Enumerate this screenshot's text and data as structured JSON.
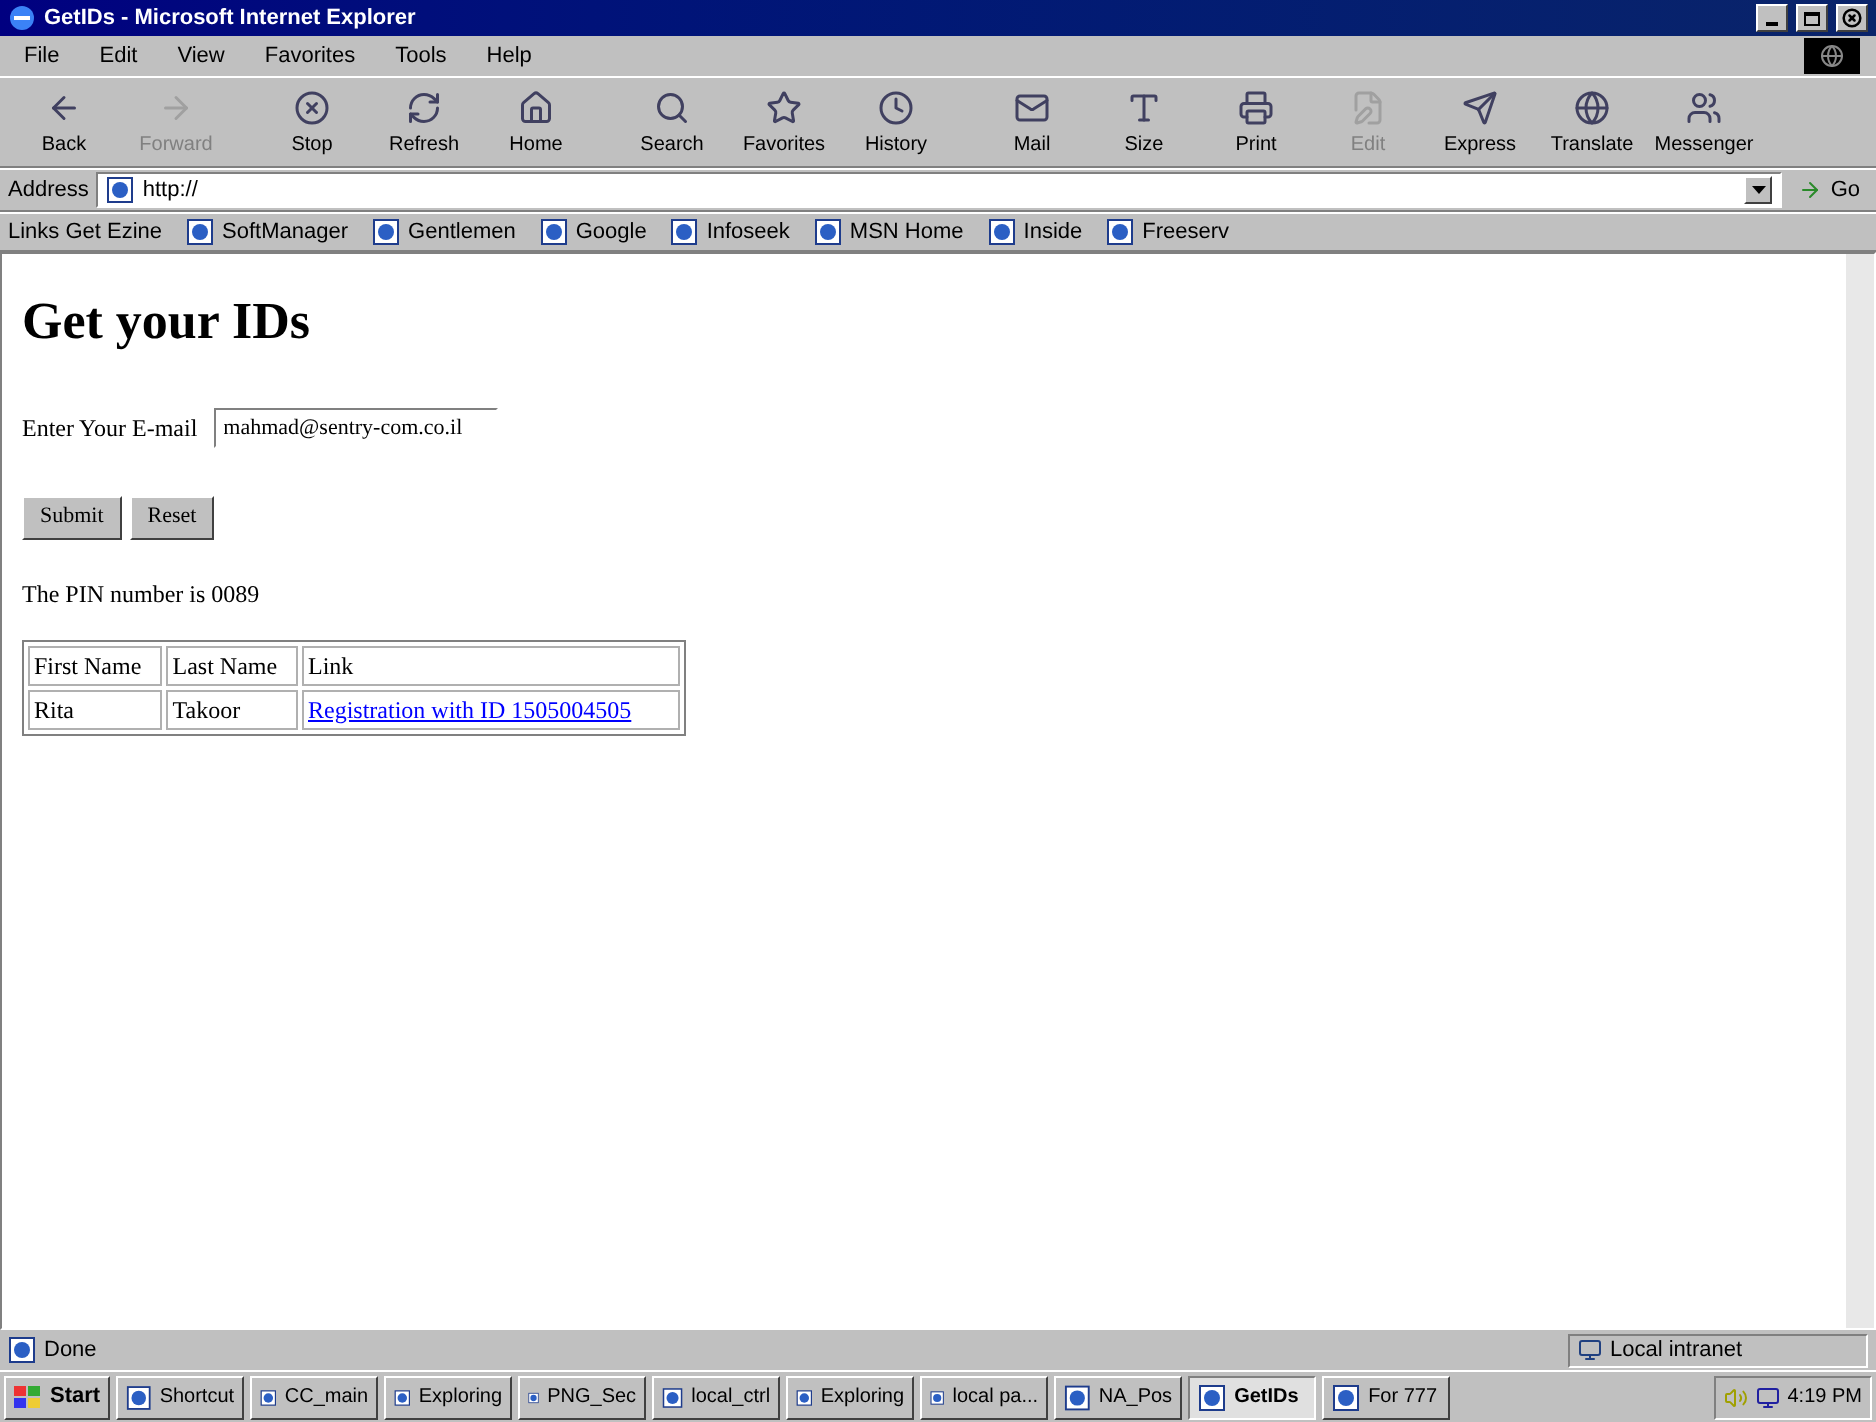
{
  "window": {
    "title": "GetIDs - Microsoft Internet Explorer"
  },
  "menu": [
    "File",
    "Edit",
    "View",
    "Favorites",
    "Tools",
    "Help"
  ],
  "toolbar": [
    {
      "label": "Back",
      "disabled": false
    },
    {
      "label": "Forward",
      "disabled": true
    },
    {
      "label": "Stop",
      "disabled": false
    },
    {
      "label": "Refresh",
      "disabled": false
    },
    {
      "label": "Home",
      "disabled": false
    },
    {
      "label": "Search",
      "disabled": false
    },
    {
      "label": "Favorites",
      "disabled": false
    },
    {
      "label": "History",
      "disabled": false
    },
    {
      "label": "Mail",
      "disabled": false
    },
    {
      "label": "Size",
      "disabled": false
    },
    {
      "label": "Print",
      "disabled": false
    },
    {
      "label": "Edit",
      "disabled": true
    },
    {
      "label": "Express",
      "disabled": false
    },
    {
      "label": "Translate",
      "disabled": false
    },
    {
      "label": "Messenger",
      "disabled": false
    }
  ],
  "address": {
    "label": "Address",
    "value": "http://",
    "go": "Go"
  },
  "links": {
    "label": "Links Get Ezine",
    "items": [
      "SoftManager",
      "Gentlemen",
      "Google",
      "Infoseek",
      "MSN Home",
      "Inside",
      "Freeserv"
    ]
  },
  "page": {
    "heading": "Get your IDs",
    "email_label": "Enter Your E-mail",
    "email_value": "mahmad@sentry-com.co.il",
    "buttons": [
      "Submit",
      "Reset"
    ],
    "pin_text": "The PIN number is 0089",
    "table": {
      "columns": [
        "First Name",
        "Last Name",
        "Link"
      ],
      "rows": [
        [
          "Rita",
          "Takoor",
          "Registration with ID 1505004505"
        ]
      ]
    }
  },
  "status_bar": {
    "text": "Done",
    "zone": "Local intranet"
  },
  "taskbar": {
    "start": "Start",
    "items": [
      {
        "label": "Shortcut",
        "selected": false
      },
      {
        "label": "CC_main",
        "selected": false
      },
      {
        "label": "Exploring",
        "selected": false
      },
      {
        "label": "PNG_Sec",
        "selected": false
      },
      {
        "label": "local_ctrl",
        "selected": false
      },
      {
        "label": "Exploring",
        "selected": false
      },
      {
        "label": "local pa...",
        "selected": false
      },
      {
        "label": "NA_Pos",
        "selected": false
      },
      {
        "label": "GetIDs",
        "selected": true
      },
      {
        "label": "For 777",
        "selected": false
      }
    ],
    "clock": "4:19 PM"
  }
}
